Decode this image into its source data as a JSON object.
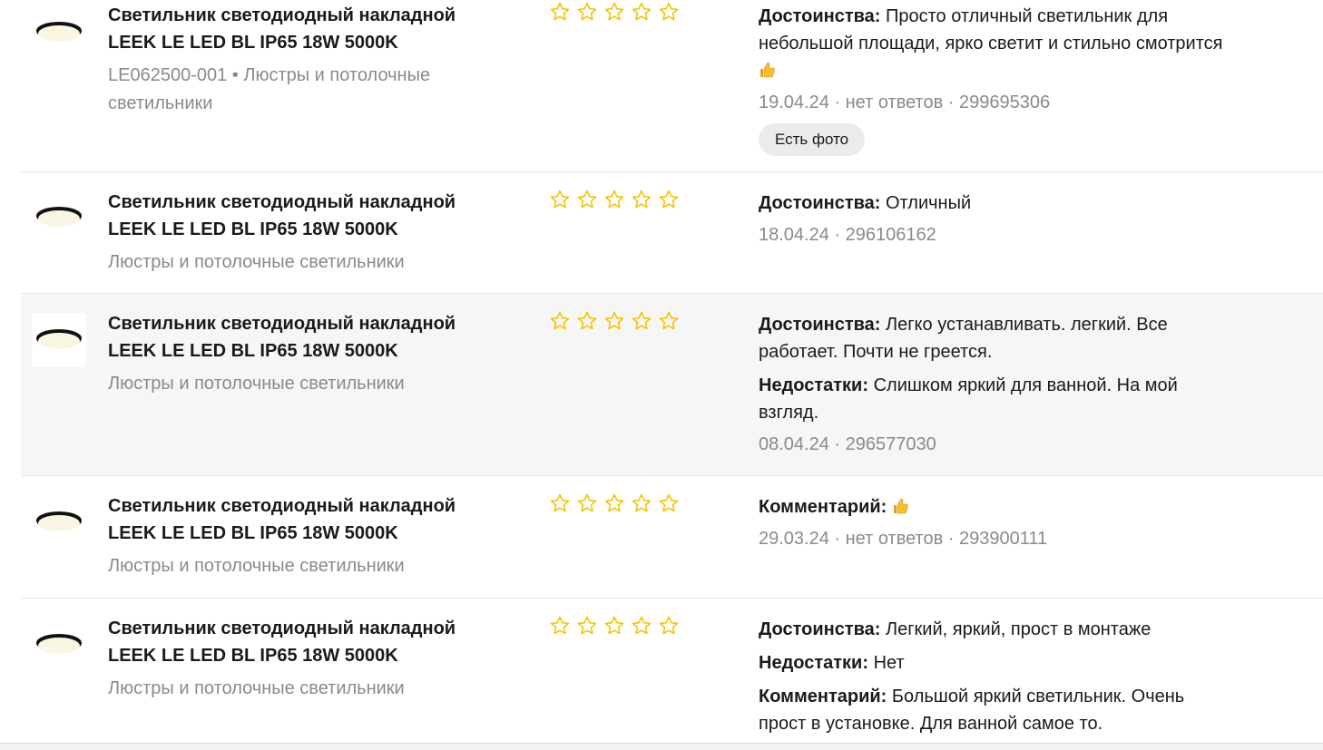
{
  "colors": {
    "star_outline": "#f5c400",
    "meta_gray": "#8a8a8a",
    "highlight_row": "#f6f6f6",
    "chip_bg": "#ebebeb"
  },
  "icons": {
    "product": "ceiling-lamp-icon",
    "rating": "star-outline-icon",
    "emoji": "thumbs-up-icon"
  },
  "reviews": [
    {
      "product_line1": "Светильник светодиодный накладной",
      "product_line2": "LEEK LE LED BL IP65 18W 5000K",
      "product_meta": "LE062500-001 • Люстры и потолочные светильники",
      "rating": 0,
      "pros_label": "Достоинства:",
      "pros_text": "Просто отличный светильник для небольшой площади, ярко светит и стильно смотрится",
      "meta": "19.04.24 · нет ответов · 299695306",
      "chip": "Есть фото"
    },
    {
      "product_line1": "Светильник светодиодный накладной",
      "product_line2": "LEEK LE LED BL IP65 18W 5000K",
      "product_meta": "Люстры и потолочные светильники",
      "rating": 0,
      "pros_label": "Достоинства:",
      "pros_text": "Отличный",
      "meta": "18.04.24 · 296106162"
    },
    {
      "product_line1": "Светильник светодиодный накладной",
      "product_line2": "LEEK LE LED BL IP65 18W 5000K",
      "product_meta": "Люстры и потолочные светильники",
      "rating": 0,
      "pros_label": "Достоинства:",
      "pros_text": "Легко устанавливать. легкий. Все работает. Почти не греется.",
      "cons_label": "Недостатки:",
      "cons_text": "Слишком яркий для ванной.  На мой взгляд.",
      "meta": "08.04.24 · 296577030"
    },
    {
      "product_line1": "Светильник светодиодный накладной",
      "product_line2": "LEEK LE LED BL IP65 18W 5000K",
      "product_meta": "Люстры и потолочные светильники",
      "rating": 0,
      "comment_label": "Комментарий:",
      "meta": "29.03.24 · нет ответов · 293900111"
    },
    {
      "product_line1": "Светильник светодиодный накладной",
      "product_line2": "LEEK LE LED BL IP65 18W 5000K",
      "product_meta": "Люстры и потолочные светильники",
      "rating": 0,
      "pros_label": "Достоинства:",
      "pros_text": "Легкий, яркий, прост в монтаже",
      "cons_label": "Недостатки:",
      "cons_text": "Нет",
      "comment_label": "Комментарий:",
      "comment_text": "Большой яркий светильник. Очень прост в установке. Для ванной самое то."
    }
  ]
}
